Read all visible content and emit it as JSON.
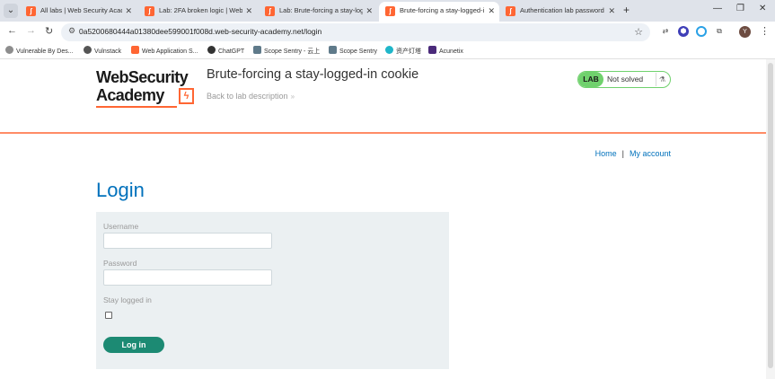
{
  "browser": {
    "tabs": [
      {
        "label": "All labs | Web Security Acade",
        "active": false
      },
      {
        "label": "Lab: 2FA broken logic | Web",
        "active": false
      },
      {
        "label": "Lab: Brute-forcing a stay-logg",
        "active": false
      },
      {
        "label": "Brute-forcing a stay-logged-i",
        "active": true
      },
      {
        "label": "Authentication lab password",
        "active": false
      }
    ],
    "url": "0a5200680444a01380dee599001f008d.web-security-academy.net/login",
    "bookmarks": [
      {
        "label": "Vulnerable By Des...",
        "color": "#8d8d8d"
      },
      {
        "label": "Vulnstack",
        "color": "#555555"
      },
      {
        "label": "Web Application S...",
        "color": "#ff6633"
      },
      {
        "label": "ChatGPT",
        "color": "#333333"
      },
      {
        "label": "Scope Sentry - 云上",
        "color": "#5f7a8a"
      },
      {
        "label": "Scope Sentry",
        "color": "#5f7a8a"
      },
      {
        "label": "资产灯塔",
        "color": "#1fb6c9"
      },
      {
        "label": "Acunetix",
        "color": "#4a2a7a"
      }
    ],
    "avatar_initial": "Y"
  },
  "header": {
    "logo_line1": "WebSecurity",
    "logo_line2": "Academy",
    "lab_title": "Brute-forcing a stay-logged-in cookie",
    "back_link": "Back to lab description",
    "badge_lab": "LAB",
    "badge_status": "Not solved"
  },
  "nav": {
    "home": "Home",
    "separator": "|",
    "account": "My account"
  },
  "login": {
    "heading": "Login",
    "username_label": "Username",
    "password_label": "Password",
    "stay_logged_label": "Stay logged in",
    "submit_label": "Log in"
  },
  "colors": {
    "accent": "#ff6633",
    "link": "#0071bc",
    "button": "#1c8a73",
    "badge": "#70d16d"
  }
}
